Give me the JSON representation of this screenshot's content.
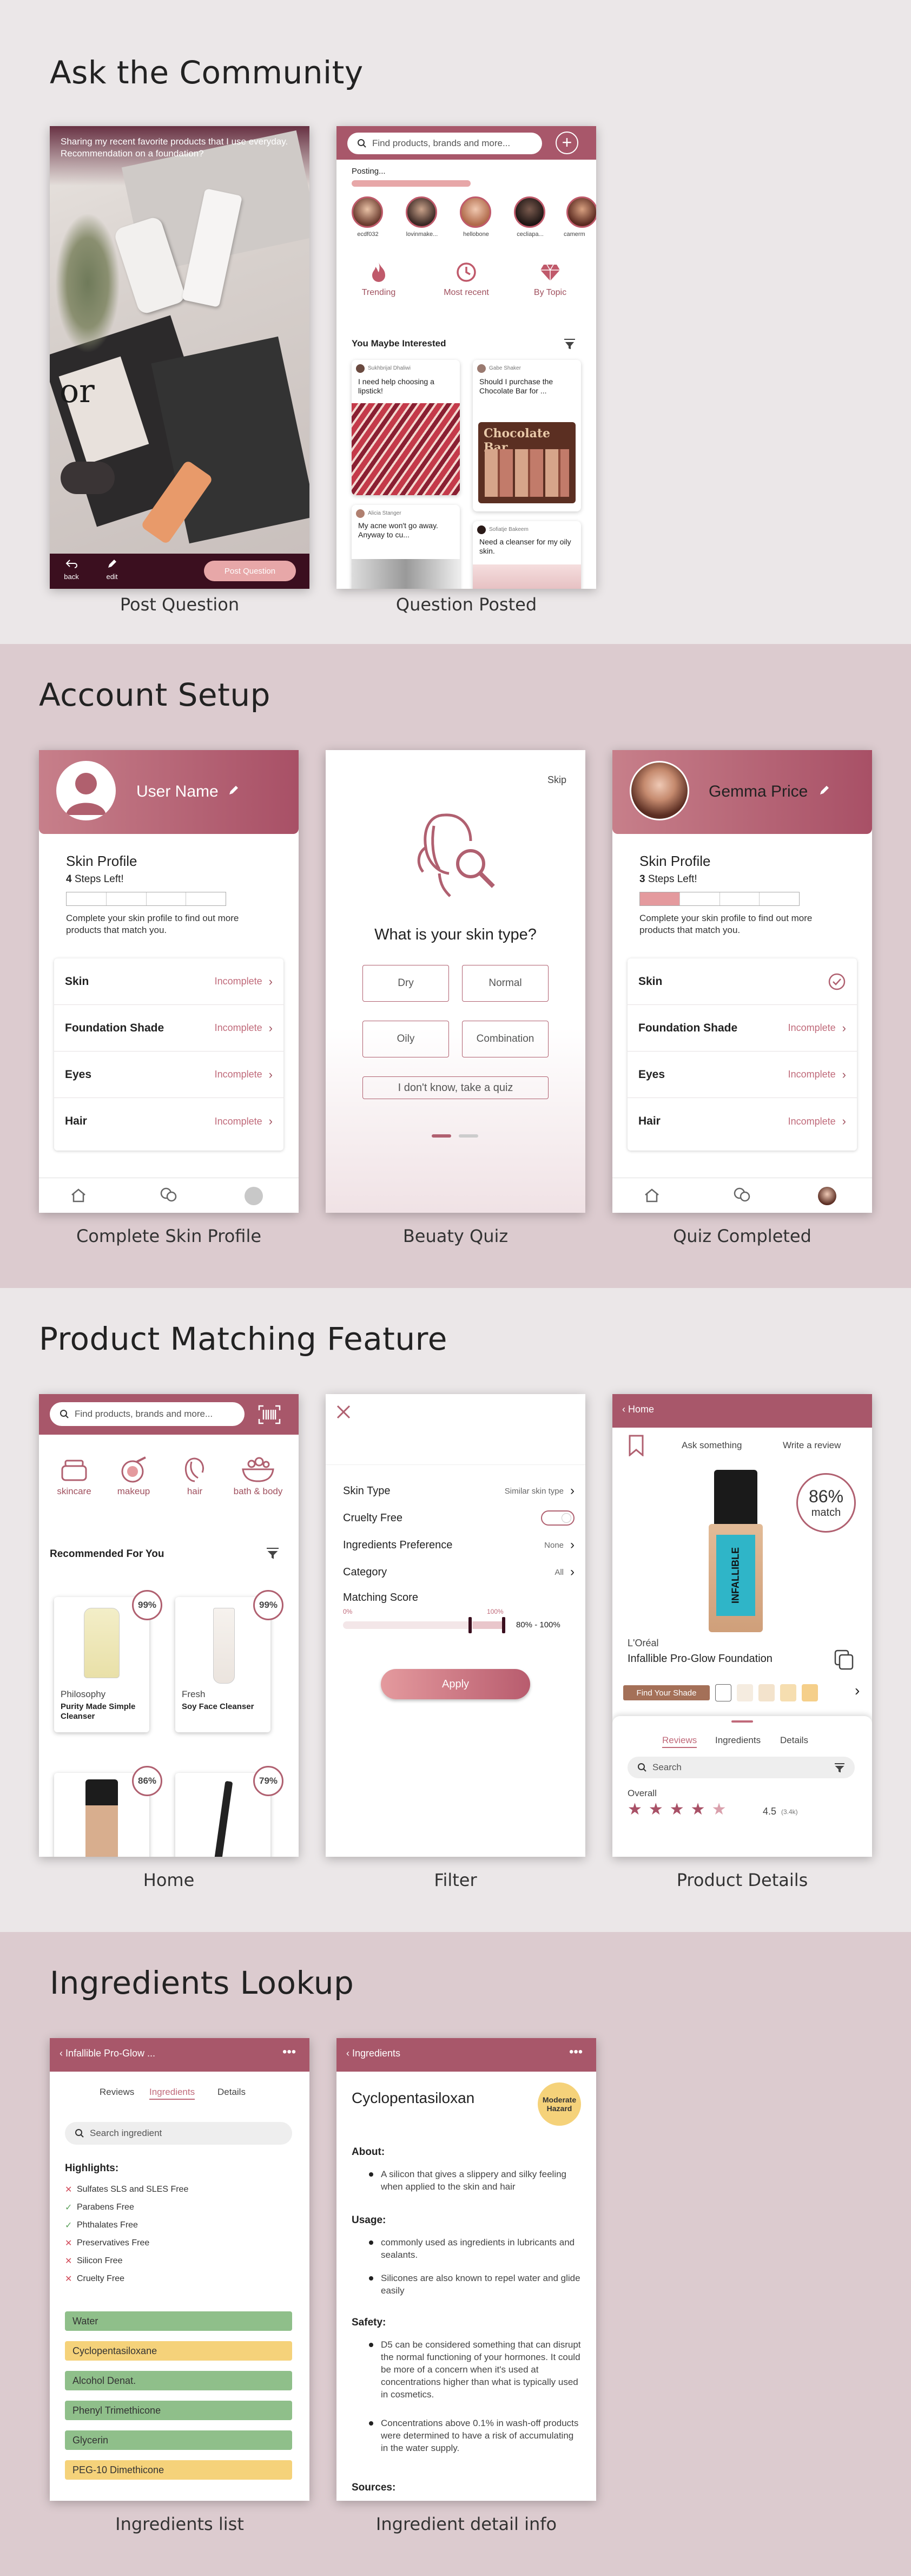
{
  "sections": {
    "community": {
      "title": "Ask the Community"
    },
    "account": {
      "title": "Account Setup"
    },
    "matching": {
      "title": "Product Matching Feature"
    },
    "ingredients": {
      "title": "Ingredients Lookup"
    }
  },
  "captions": {
    "post_question": "Post Question",
    "question_posted": "Question Posted",
    "complete_skin": "Complete Skin Profile",
    "beauty_quiz": "Beuaty Quiz",
    "quiz_completed": "Quiz Completed",
    "home": "Home",
    "filter": "Filter",
    "product_details": "Product Details",
    "ing_list": "Ingredients list",
    "ing_detail": "Ingredient detail info"
  },
  "post_question": {
    "question": "Sharing my recent favorite products that I use everyday. Recommendation on a foundation?",
    "back": "back",
    "edit": "edit",
    "post_button": "Post Question"
  },
  "question_posted": {
    "search_placeholder": "Find products, brands and more...",
    "posting": "Posting...",
    "users": [
      "ecdf032",
      "lovinmake...",
      "hellobone",
      "cecliapa...",
      "camerm"
    ],
    "filters": [
      "Trending",
      "Most recent",
      "By Topic"
    ],
    "interested": "You Maybe Interested",
    "cards": [
      {
        "user": "Sukhbrijal Dhaliwi",
        "text": "I need help choosing a lipstick!"
      },
      {
        "user": "Gabe Shaker",
        "text": "Should I purchase the Chocolate Bar for ..."
      },
      {
        "user": "Alicia Stanger",
        "text": "My acne won't go away. Anyway to cu..."
      },
      {
        "user": "Sofiatje Bakeem",
        "text": "Need a cleanser for my oily skin."
      }
    ],
    "palette_label": "Chocolate Bar"
  },
  "skin_profile_a": {
    "user_name": "User Name",
    "title": "Skin Profile",
    "steps_count": "4",
    "steps_text": " Steps Left!",
    "desc": "Complete your skin profile to find out more products that match you.",
    "progress": 0,
    "rows": [
      {
        "label": "Skin",
        "status": "Incomplete"
      },
      {
        "label": "Foundation Shade",
        "status": "Incomplete"
      },
      {
        "label": "Eyes",
        "status": "Incomplete"
      },
      {
        "label": "Hair",
        "status": "Incomplete"
      }
    ]
  },
  "quiz": {
    "skip": "Skip",
    "question": "What is your skin type?",
    "options": [
      "Dry",
      "Normal",
      "Oily",
      "Combination"
    ],
    "dont_know": "I don't know, take a quiz"
  },
  "skin_profile_b": {
    "user_name": "Gemma Price",
    "title": "Skin Profile",
    "steps_count": "3",
    "steps_text": " Steps Left!",
    "desc": "Complete your skin profile to find out more products that match you.",
    "progress": 0.25,
    "rows": [
      {
        "label": "Skin",
        "status": ""
      },
      {
        "label": "Foundation Shade",
        "status": "Incomplete"
      },
      {
        "label": "Eyes",
        "status": "Incomplete"
      },
      {
        "label": "Hair",
        "status": "Incomplete"
      }
    ]
  },
  "home": {
    "search_placeholder": "Find products, brands and more...",
    "categories": [
      "skincare",
      "makeup",
      "hair",
      "bath & body"
    ],
    "recommended": "Recommended For You",
    "products": [
      {
        "brand": "Philosophy",
        "name": "Purity Made Simple Cleanser",
        "match": "99%"
      },
      {
        "brand": "Fresh",
        "name": "Soy Face Cleanser",
        "match": "99%"
      },
      {
        "brand": "",
        "name": "",
        "match": "86%"
      },
      {
        "brand": "",
        "name": "",
        "match": "79%"
      }
    ]
  },
  "filter": {
    "rows": [
      {
        "label": "Skin Type",
        "value": "Similar skin type"
      },
      {
        "label": "Cruelty Free",
        "value": ""
      },
      {
        "label": "Ingredients Preference",
        "value": "None"
      },
      {
        "label": "Category",
        "value": "All"
      }
    ],
    "score_label": "Matching Score",
    "min": "0%",
    "max": "100%",
    "range": "80% - 100%",
    "apply": "Apply"
  },
  "product": {
    "back": "Home",
    "ask": "Ask something",
    "review": "Write a review",
    "match_pct": "86%",
    "match_word": "match",
    "brand": "L'Oréal",
    "name": "Infallible Pro-Glow Foundation",
    "find_shade": "Find Your Shade",
    "tabs": [
      "Reviews",
      "Ingredients",
      "Details"
    ],
    "search": "Search",
    "overall": "Overall",
    "rating": "4.5",
    "rating_count": "(3.4k)",
    "bottle_text": "INFALLIBLE"
  },
  "ing_list": {
    "header": "Infallible Pro-Glow ...",
    "tabs": [
      "Reviews",
      "Ingredients",
      "Details"
    ],
    "search": "Search ingredient",
    "highlights": "Highlights:",
    "items": [
      {
        "mark": "✕",
        "text": "Sulfates SLS and SLES Free"
      },
      {
        "mark": "✓",
        "text": "Parabens Free"
      },
      {
        "mark": "✓",
        "text": "Phthalates Free"
      },
      {
        "mark": "✕",
        "text": "Preservatives Free"
      },
      {
        "mark": "✕",
        "text": "Silicon Free"
      },
      {
        "mark": "✕",
        "text": "Cruelty Free"
      }
    ],
    "ingredients": [
      {
        "name": "Water",
        "color": "#8fbf8a"
      },
      {
        "name": "Cyclopentasiloxane",
        "color": "#f5d27a"
      },
      {
        "name": "Alcohol Denat.",
        "color": "#8fbf8a"
      },
      {
        "name": "Phenyl Trimethicone",
        "color": "#8fbf8a"
      },
      {
        "name": "Glycerin",
        "color": "#8fbf8a"
      },
      {
        "name": "PEG-10 Dimethicone",
        "color": "#f5d27a"
      }
    ]
  },
  "ing_detail": {
    "header": "Ingredients",
    "name": "Cyclopentasiloxan",
    "hazard": "Moderate Hazard",
    "about": "About:",
    "about_text": "A silicon that gives a slippery and silky feeling when applied to the skin and hair",
    "usage": "Usage:",
    "usage_1": "commonly used as ingredients in lubricants and sealants.",
    "usage_2": "Silicones are also known to repel water and glide easily",
    "safety": "Safety:",
    "safety_1": "D5 can be considered something that can disrupt the normal functioning of your hormones. It could be more of a concern when it's used at concentrations higher than what is typically used in cosmetics.",
    "safety_2": "Concentrations above 0.1% in wash-off products were determined to have a risk of accumulating in the water supply.",
    "sources": "Sources:"
  }
}
